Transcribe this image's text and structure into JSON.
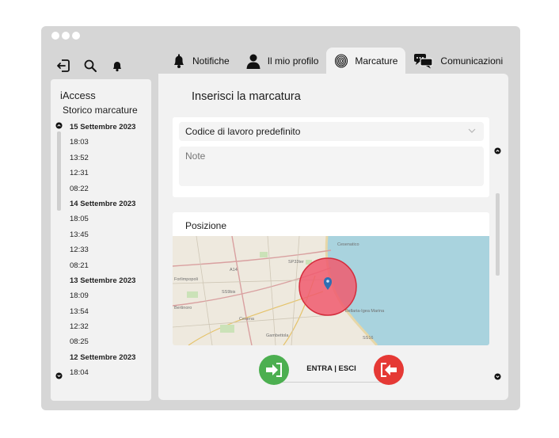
{
  "window": {
    "dots": 3,
    "top_icons": [
      "logout-icon",
      "search-icon",
      "bell-icon"
    ]
  },
  "tabs": [
    {
      "label": "Notifiche",
      "icon": "bell-icon",
      "active": false
    },
    {
      "label": "Il mio profilo",
      "icon": "user-icon",
      "active": false
    },
    {
      "label": "Marcature",
      "icon": "fingerprint-icon",
      "active": true
    },
    {
      "label": "Comunicazioni",
      "icon": "chat-icon",
      "active": false
    }
  ],
  "sidebar": {
    "app_name": "iAccess",
    "history_title": "Storico marcature",
    "entries": [
      {
        "text": "15 Settembre 2023",
        "date": true
      },
      {
        "text": "18:03",
        "date": false
      },
      {
        "text": "13:52",
        "date": false
      },
      {
        "text": "12:31",
        "date": false
      },
      {
        "text": "08:22",
        "date": false
      },
      {
        "text": "14 Settembre 2023",
        "date": true
      },
      {
        "text": "18:05",
        "date": false
      },
      {
        "text": "13:45",
        "date": false
      },
      {
        "text": "12:33",
        "date": false
      },
      {
        "text": "08:21",
        "date": false
      },
      {
        "text": "13 Settembre 2023",
        "date": true
      },
      {
        "text": "18:09",
        "date": false
      },
      {
        "text": "13:54",
        "date": false
      },
      {
        "text": "12:32",
        "date": false
      },
      {
        "text": "08:25",
        "date": false
      },
      {
        "text": "12 Settembre 2023",
        "date": true
      },
      {
        "text": "18:04",
        "date": false
      }
    ]
  },
  "main": {
    "title": "Inserisci la marcatura",
    "work_code_select": "Codice di lavoro predefinito",
    "notes_placeholder": "Note",
    "position_label": "Posizione",
    "action_label": "ENTRA | ESCI"
  },
  "map": {
    "places": [
      "A14",
      "SS9bis",
      "Bertinoro",
      "Cesena",
      "Gambettola",
      "Forlimpopoli",
      "SP33ter",
      "SS16",
      "Cesenatico",
      "Bellaria-Igea Marina"
    ],
    "sea_color": "#a9d3de",
    "land_color": "#eee9de",
    "radius_color": "#f05a6e",
    "radius_stroke": "#d42c3c",
    "pin_color": "#2f6fb3"
  },
  "colors": {
    "enter": "#4caf50",
    "exit": "#e53935"
  }
}
